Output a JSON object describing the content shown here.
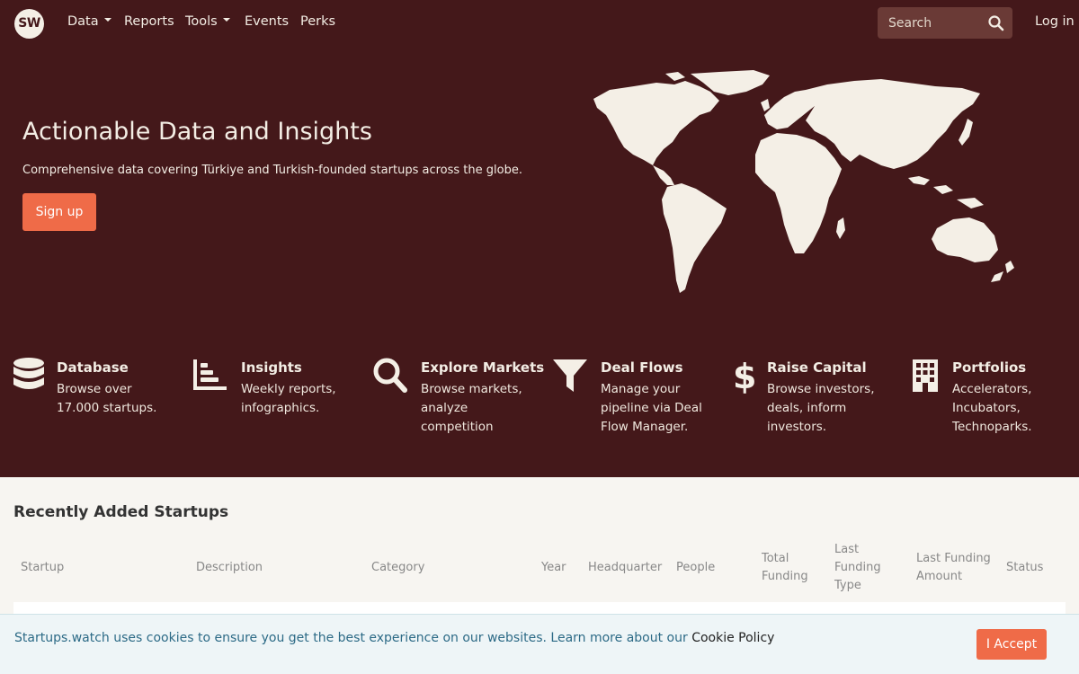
{
  "nav": {
    "logo": "SW",
    "items": [
      {
        "label": "Data",
        "dropdown": true
      },
      {
        "label": "Reports",
        "dropdown": false
      },
      {
        "label": "Tools",
        "dropdown": true
      },
      {
        "label": "Events",
        "dropdown": false
      },
      {
        "label": "Perks",
        "dropdown": false
      }
    ],
    "search_placeholder": "Search",
    "login": "Log in"
  },
  "hero": {
    "title": "Actionable Data and Insights",
    "subtitle": "Comprehensive data covering Türkiye and Turkish-founded startups across the globe.",
    "cta": "Sign up"
  },
  "features": [
    {
      "icon": "database-icon",
      "title": "Database",
      "desc": "Browse over 17.000 startups."
    },
    {
      "icon": "bar-chart-icon",
      "title": "Insights",
      "desc": "Weekly reports, infographics."
    },
    {
      "icon": "search-icon",
      "title": "Explore Markets",
      "desc": "Browse markets, analyze competition"
    },
    {
      "icon": "funnel-icon",
      "title": "Deal Flows",
      "desc": "Manage your pipeline via Deal Flow Manager."
    },
    {
      "icon": "dollar-icon",
      "title": "Raise Capital",
      "desc": "Browse investors, deals, inform investors."
    },
    {
      "icon": "building-icon",
      "title": "Portfolios",
      "desc": "Accelerators, Incubators, Technoparks."
    }
  ],
  "recent": {
    "title": "Recently Added Startups",
    "columns": [
      "Startup",
      "Description",
      "Category",
      "Year",
      "Headquarter",
      "People",
      "Total Funding",
      "Last Funding Type",
      "Last Funding Amount",
      "Status"
    ]
  },
  "cookie": {
    "text": "Startups.watch uses cookies to ensure you get the best experience on our websites. Learn more about our ",
    "link": "Cookie Policy",
    "accept": "I Accept"
  },
  "colors": {
    "hero_bg": "#44181a",
    "accent": "#ef6b48",
    "page_bg": "#f7f5f1",
    "cookie_bg": "#eef5f7"
  }
}
